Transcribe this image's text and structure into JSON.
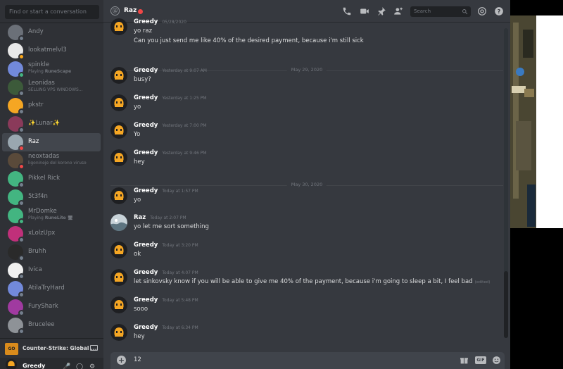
{
  "sidebar": {
    "search_placeholder": "Find or start a conversation",
    "dms": [
      {
        "name": "Andy",
        "status": "offline"
      },
      {
        "name": "lookatmelvl3",
        "status": "idle"
      },
      {
        "name": "spinkle",
        "activity_prefix": "Playing ",
        "activity_game": "RuneScape",
        "status": "online"
      },
      {
        "name": "Leonidas",
        "activity": "SELLING VPS WINDOWS...",
        "status": "offline"
      },
      {
        "name": "pkstr",
        "status": "offline"
      },
      {
        "name": "✨Lunar✨",
        "status": "offline"
      },
      {
        "name": "Raz",
        "status": "dnd",
        "active": true
      },
      {
        "name": "neoxtadas",
        "activity": "ligonineje del korono viruso",
        "status": "dnd"
      },
      {
        "name": "Pikkel Rick",
        "status": "offline"
      },
      {
        "name": "5t3f4n",
        "status": "offline"
      },
      {
        "name": "MrDomke",
        "activity_prefix": "Playing ",
        "activity_game": "RuneLite 🖥",
        "status": "online"
      },
      {
        "name": "xLolzUpx",
        "status": "offline"
      },
      {
        "name": "Bruhh",
        "status": "offline"
      },
      {
        "name": "Ivica",
        "status": "offline"
      },
      {
        "name": "AtilaTryHard",
        "status": "offline"
      },
      {
        "name": "FuryShark",
        "status": "offline"
      },
      {
        "name": "Brucelee",
        "status": "offline"
      }
    ],
    "game_bar": {
      "icon_text": "GO",
      "name": "Counter-Strike: Global ..."
    },
    "user": {
      "name": "Greedy"
    }
  },
  "header": {
    "recipient": "Raz",
    "search_placeholder": "Search",
    "icons": [
      "call-icon",
      "video-icon",
      "pin-icon",
      "add-friend-icon",
      "search-icon",
      "mention-icon",
      "help-icon"
    ]
  },
  "messages": [
    {
      "type": "msg",
      "author": "Greedy",
      "timestamp": "05/28/2020",
      "lines": [
        "yo raz",
        "Can you just send me like 40% of the desired payment, because i'm still sick"
      ]
    },
    {
      "type": "divider",
      "label": "May 29, 2020"
    },
    {
      "type": "msg",
      "author": "Greedy",
      "timestamp": "Yesterday at 9:07 AM",
      "lines": [
        "busy?"
      ]
    },
    {
      "type": "msg",
      "author": "Greedy",
      "timestamp": "Yesterday at 1:25 PM",
      "lines": [
        "yo"
      ]
    },
    {
      "type": "msg",
      "author": "Greedy",
      "timestamp": "Yesterday at 7:00 PM",
      "lines": [
        "Yo"
      ]
    },
    {
      "type": "msg",
      "author": "Greedy",
      "timestamp": "Yesterday at 9:46 PM",
      "lines": [
        "hey"
      ]
    },
    {
      "type": "divider",
      "label": "May 30, 2020"
    },
    {
      "type": "msg",
      "author": "Greedy",
      "timestamp": "Today at 1:57 PM",
      "lines": [
        "yo"
      ]
    },
    {
      "type": "msg",
      "author": "Raz",
      "timestamp": "Today at 2:07 PM",
      "lines": [
        "yo let me sort something"
      ]
    },
    {
      "type": "msg",
      "author": "Greedy",
      "timestamp": "Today at 3:20 PM",
      "lines": [
        "ok"
      ]
    },
    {
      "type": "msg",
      "author": "Greedy",
      "timestamp": "Today at 4:07 PM",
      "lines": [
        "let sinkovsky know if you will be able to give me 40% of the payment, because i'm going to sleep a bit,  I feel bad"
      ],
      "edited": "(edited)"
    },
    {
      "type": "msg",
      "author": "Greedy",
      "timestamp": "Today at 5:48 PM",
      "lines": [
        "sooo"
      ]
    },
    {
      "type": "msg",
      "author": "Greedy",
      "timestamp": "Today at 6:34 PM",
      "lines": [
        "hey"
      ]
    }
  ],
  "composer": {
    "value": "12",
    "icons": [
      "gift-icon",
      "gif-icon",
      "emoji-icon"
    ],
    "gif_label": "GIF"
  },
  "colors": {
    "sidebar_bg": "#2f3136",
    "chat_bg": "#36393f",
    "greedy_avatar_bg": "#1e1f22",
    "greedy_avatar_accent": "#f5a623",
    "status_dnd": "#f04747",
    "status_online": "#43b581",
    "status_offline": "#747f8d",
    "status_idle": "#faa61a"
  }
}
